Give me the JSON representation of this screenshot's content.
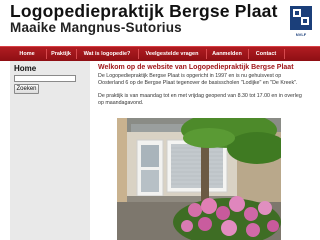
{
  "header": {
    "title": "Logopediepraktijk Bergse Plaat",
    "subtitle": "Maaike Mangnus-Sutorius",
    "logo_text": "NVLF"
  },
  "nav": {
    "items": [
      {
        "label": "Home"
      },
      {
        "label": "Praktijk"
      },
      {
        "label": "Wat is logopedie?"
      },
      {
        "label": "Veelgestelde vragen"
      },
      {
        "label": "Aanmelden"
      },
      {
        "label": "Contact"
      }
    ]
  },
  "sidebar": {
    "title": "Home",
    "search_placeholder": "",
    "search_button": "Zoeken"
  },
  "main": {
    "heading": "Welkom op de website van Logopediepraktijk Bergse Plaat",
    "intro": "De Logopediepraktijk Bergse Plaat is opgericht in 1997 en is nu gehuisvest op Oosterland 6 op de Bergse Plaat tegenover de basisscholen \"Lodijke\" en \"De Kreek\".",
    "hours": "De praktijk is van maandag tot en met vrijdag geopend van 8.30 tot 17.00 en in overleg op maandagavond."
  },
  "colors": {
    "nav_background": "#9e151a",
    "heading": "#a0171b",
    "sidebar_background": "#e9e9e9",
    "logo_blue": "#1b3f7a"
  },
  "icons": {
    "logo": "nvlf-logo-icon"
  }
}
